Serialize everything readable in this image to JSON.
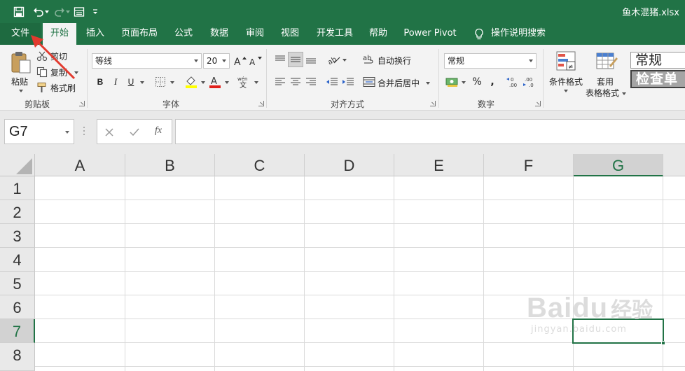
{
  "window": {
    "title": "鱼木混猪.xlsx"
  },
  "colors": {
    "accent": "#217346",
    "arrow": "#e23a2e"
  },
  "qat": {
    "icons": [
      "save-icon",
      "undo-icon",
      "redo-icon",
      "form-icon",
      "customize-icon"
    ]
  },
  "tabs": [
    {
      "label": "文件"
    },
    {
      "label": "开始"
    },
    {
      "label": "插入"
    },
    {
      "label": "页面布局"
    },
    {
      "label": "公式"
    },
    {
      "label": "数据"
    },
    {
      "label": "审阅"
    },
    {
      "label": "视图"
    },
    {
      "label": "开发工具"
    },
    {
      "label": "帮助"
    },
    {
      "label": "Power Pivot"
    },
    {
      "label": "操作说明搜索"
    }
  ],
  "ribbon": {
    "clipboard": {
      "label": "剪贴板",
      "paste": "粘贴",
      "cut": "剪切",
      "copy": "复制",
      "format_painter": "格式刷"
    },
    "font": {
      "label": "字体",
      "font_name": "等线",
      "font_size": "20",
      "bold": "B",
      "italic": "I",
      "underline": "U"
    },
    "alignment": {
      "label": "对齐方式",
      "wrap": "自动换行",
      "merge": "合并后居中"
    },
    "number": {
      "label": "数字",
      "format": "常规",
      "percent": "%",
      "comma": ","
    },
    "styles": {
      "conditional": "条件格式",
      "table_line1": "套用",
      "table_line2": "表格格式",
      "style_normal": "常规",
      "style_check": "检查单"
    }
  },
  "formula_bar": {
    "name_box": "G7",
    "fx": "fx",
    "value": ""
  },
  "grid": {
    "columns": [
      "A",
      "B",
      "C",
      "D",
      "E",
      "F",
      "G"
    ],
    "rows": [
      "1",
      "2",
      "3",
      "4",
      "5",
      "6",
      "7",
      "8"
    ],
    "selected_cell": "G7"
  },
  "watermark": {
    "brand": "Baidu",
    "cn": "经验",
    "url": "jingyan.baidu.com"
  }
}
